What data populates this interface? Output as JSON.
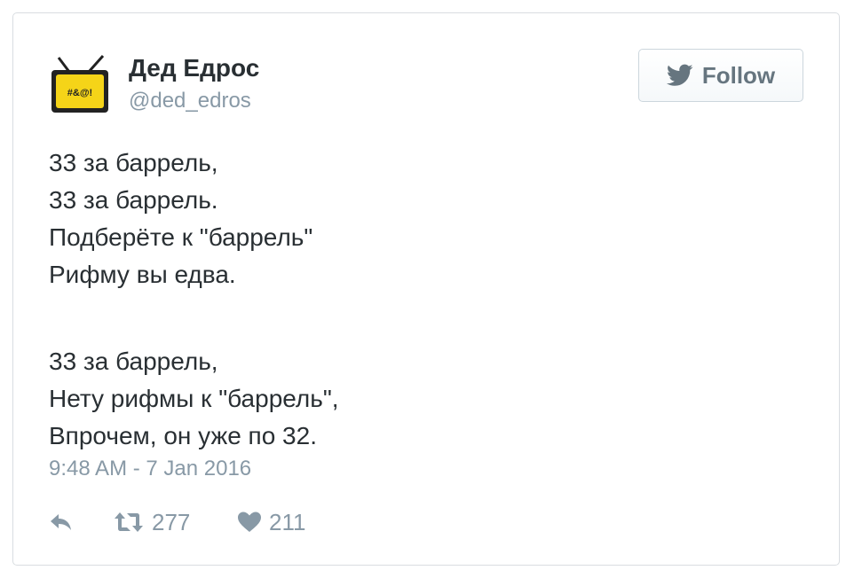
{
  "author": {
    "display_name": "Дед Едрос",
    "handle": "@ded_edros",
    "avatar_icon": "tv-avatar-icon",
    "avatar_text": "#&@!"
  },
  "follow_button": {
    "label": "Follow",
    "icon": "twitter-bird-icon"
  },
  "tweet": {
    "stanza1": [
      "33 за баррель,",
      "33 за баррель.",
      "Подберёте к \"баррель\"",
      "Рифму вы едва."
    ],
    "stanza2": [
      "33 за баррель,",
      "Нету рифмы к \"баррель\",",
      "Впрочем, он уже по 32."
    ],
    "timestamp": "9:48 AM - 7 Jan 2016"
  },
  "actions": {
    "reply_icon": "reply-icon",
    "retweet_icon": "retweet-icon",
    "retweet_count": "277",
    "like_icon": "heart-icon",
    "like_count": "211"
  },
  "colors": {
    "name": "#292f33",
    "secondary": "#8899a6",
    "avatar_yellow": "#f5d418",
    "icon_gray": "#8899a6",
    "bird": "#66757f"
  }
}
